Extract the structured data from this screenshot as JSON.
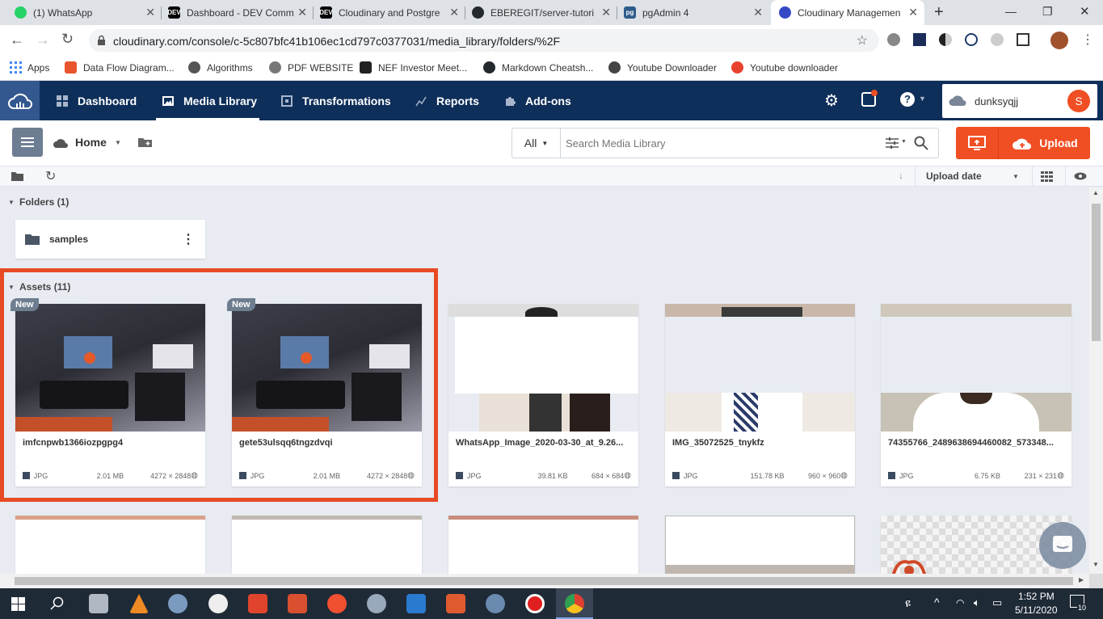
{
  "browser": {
    "tabs": [
      {
        "title": "(1) WhatsApp",
        "color": "#25d366"
      },
      {
        "title": "Dashboard - DEV Comm",
        "color": "#000000"
      },
      {
        "title": "Cloudinary and Postgre",
        "color": "#000000"
      },
      {
        "title": "EBEREGIT/server-tutori",
        "color": "#24292e"
      },
      {
        "title": "pgAdmin 4",
        "color": "#2e5b8a"
      },
      {
        "title": "Cloudinary Managemen",
        "color": "#3448c5"
      }
    ],
    "fav_text": {
      "dev": "DEV",
      "pg": "pg"
    },
    "new_tab": "+",
    "url": "cloudinary.com/console/c-5c807bfc41b106ec1cd797c0377031/media_library/folders/%2F",
    "bookmarks": [
      {
        "label": "Apps",
        "color": "#4285f4"
      },
      {
        "label": "Data Flow Diagram...",
        "color": "#e8542d"
      },
      {
        "label": "Algorithms",
        "color": "#555555"
      },
      {
        "label": "PDF WEBSITE",
        "color": "#777777"
      },
      {
        "label": "NEF Investor Meet...",
        "color": "#222222"
      },
      {
        "label": "Markdown Cheatsh...",
        "color": "#24292e"
      },
      {
        "label": "Youtube Downloader",
        "color": "#444444"
      },
      {
        "label": "Youtube downloader",
        "color": "#e8422d"
      }
    ]
  },
  "nav": {
    "items": [
      {
        "label": "Dashboard"
      },
      {
        "label": "Media Library"
      },
      {
        "label": "Transformations"
      },
      {
        "label": "Reports"
      },
      {
        "label": "Add-ons"
      }
    ],
    "account_name": "dunksyqjj",
    "avatar_letter": "S",
    "brand_color": "#0e2f5a",
    "accent_color": "#f04e23"
  },
  "toolbar": {
    "home_label": "Home",
    "filter_label": "All",
    "search_placeholder": "Search Media Library",
    "upload_label": "Upload"
  },
  "subbar": {
    "sort_label": "Upload date"
  },
  "folders": {
    "header": "Folders (1)",
    "items": [
      {
        "name": "samples"
      }
    ]
  },
  "assets": {
    "header": "Assets (11)",
    "items": [
      {
        "name": "imfcnpwb1366iozpgpg4",
        "format": "JPG",
        "size": "2.01 MB",
        "dims": "4272 × 2848",
        "badge": "New"
      },
      {
        "name": "gete53ulsqq6tngzdvqi",
        "format": "JPG",
        "size": "2.01 MB",
        "dims": "4272 × 2848",
        "badge": "New"
      },
      {
        "name": "WhatsApp_Image_2020-03-30_at_9.26...",
        "format": "JPG",
        "size": "39.81 KB",
        "dims": "684 × 684",
        "badge": ""
      },
      {
        "name": "IMG_35072525_tnykfz",
        "format": "JPG",
        "size": "151.78 KB",
        "dims": "960 × 960",
        "badge": ""
      },
      {
        "name": "74355766_2489638694460082_573348...",
        "format": "JPG",
        "size": "6.75 KB",
        "dims": "231 × 231",
        "badge": ""
      }
    ]
  },
  "taskbar": {
    "time": "1:52 PM",
    "date": "5/11/2020",
    "notifications": "10"
  }
}
